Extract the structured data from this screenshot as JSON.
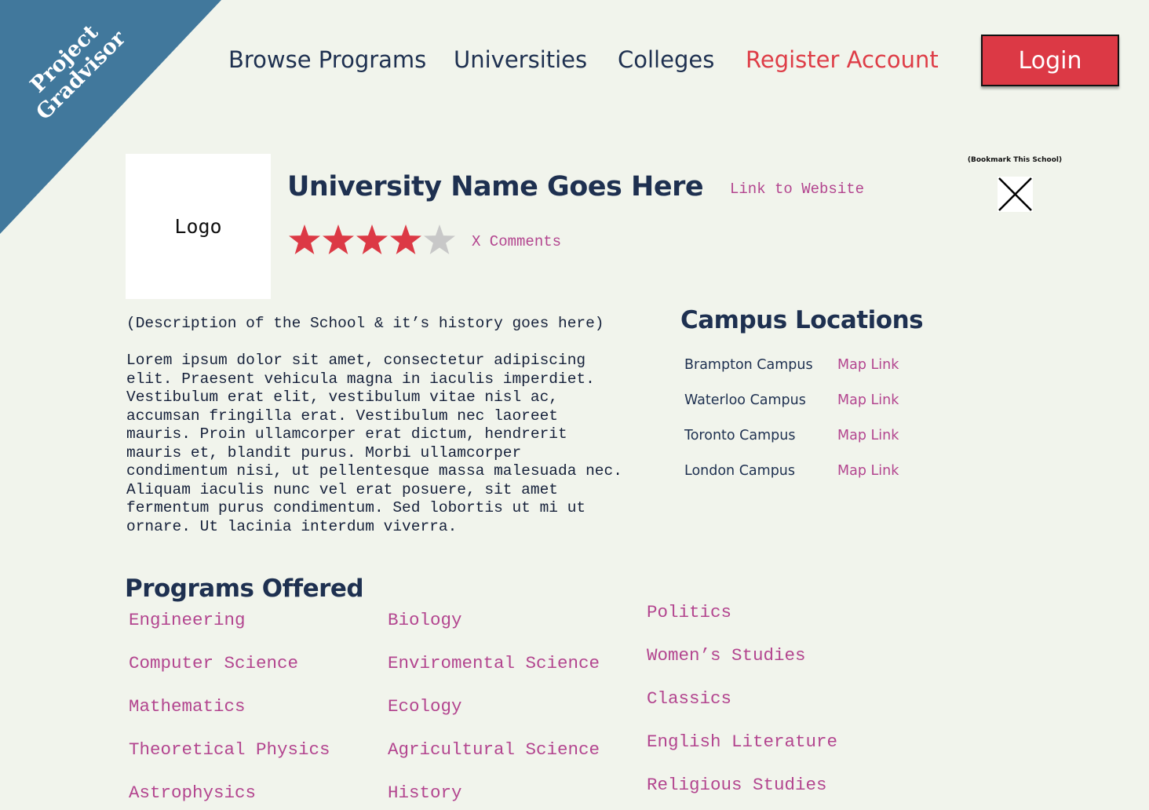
{
  "brand": {
    "line1": "Project",
    "line2": "Gradvisor"
  },
  "nav": {
    "browse_programs": "Browse Programs",
    "universities": "Universities",
    "colleges": "Colleges",
    "register_account": "Register Account",
    "login": "Login"
  },
  "school": {
    "logo_placeholder": "Logo",
    "name": "University Name Goes Here",
    "website_link": "Link to Website",
    "rating": 4,
    "rating_max": 5,
    "comments_link": "X Comments",
    "bookmark_label": "(Bookmark This School)"
  },
  "description": {
    "intro": "(Description of the School & it’s history goes here)",
    "body": "Lorem ipsum dolor sit amet, consectetur adipiscing elit. Praesent vehicula magna in iaculis imperdiet. Vestibulum erat elit, vestibulum vitae nisl ac, accumsan fringilla erat. Vestibulum nec laoreet mauris. Proin ullamcorper erat dictum, hendrerit mauris et, blandit purus. Morbi ullamcorper condimentum nisi, ut pellentesque massa malesuada nec. Aliquam iaculis nunc vel erat posuere, sit amet fermentum purus condimentum. Sed lobortis ut mi ut ornare. Ut lacinia interdum viverra."
  },
  "campus": {
    "title": "Campus Locations",
    "locations": [
      {
        "name": "Brampton Campus",
        "map": "Map Link"
      },
      {
        "name": "Waterloo Campus",
        "map": "Map Link"
      },
      {
        "name": "Toronto Campus",
        "map": "Map Link"
      },
      {
        "name": "London Campus",
        "map": "Map Link"
      }
    ]
  },
  "programs": {
    "title": "Programs Offered",
    "columns": [
      [
        "Engineering",
        "Computer Science",
        "Mathematics",
        "Theoretical Physics",
        "Astrophysics"
      ],
      [
        "Biology",
        "Enviromental Science",
        "Ecology",
        "Agricultural Science",
        "History"
      ],
      [
        "Politics",
        "Women’s Studies",
        "Classics",
        "English Literature",
        "Religious Studies"
      ]
    ]
  },
  "colors": {
    "background": "#f1f4ec",
    "navy": "#1e3050",
    "accent_red": "#dc3945",
    "link_magenta": "#b3458f",
    "corner_blue": "#41789c",
    "star_filled": "#dc3945",
    "star_empty": "#c8c8c8"
  }
}
